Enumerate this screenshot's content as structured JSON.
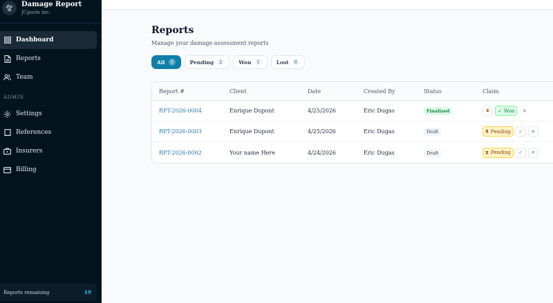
{
  "brand": {
    "title": "Damage Report",
    "subtitle": "JCpools inc."
  },
  "nav": {
    "dashboard": "Dashboard",
    "reports": "Reports",
    "team": "Team",
    "admin_label": "ADMIN",
    "settings": "Settings",
    "references": "References",
    "insurers": "Insurers",
    "billing": "Billing"
  },
  "remaining": {
    "label": "Reports remaining",
    "count": "19"
  },
  "page": {
    "title": "Reports",
    "subtitle": "Manage your damage assessment reports"
  },
  "filters": [
    {
      "label": "All",
      "count": "3",
      "active": true
    },
    {
      "label": "Pending",
      "count": "2"
    },
    {
      "label": "Won",
      "count": "1"
    },
    {
      "label": "Lost",
      "count": "0"
    }
  ],
  "table": {
    "headers": [
      "Report #",
      "Client",
      "Date",
      "Created By",
      "Status",
      "Claim"
    ],
    "rows": [
      {
        "report": "RPT-2026-0004",
        "client": "Enrique Dupont",
        "date": "4/25/2026",
        "created_by": "Eric Dugas",
        "status": "Finalized",
        "claim": "Won"
      },
      {
        "report": "RPT-2026-0003",
        "client": "Enrique Dupont",
        "date": "4/25/2026",
        "created_by": "Eric Dugas",
        "status": "Draft",
        "claim": "Pending"
      },
      {
        "report": "RPT-2026-0002",
        "client": "Your name Here",
        "date": "4/24/2026",
        "created_by": "Eric Dugas",
        "status": "Draft",
        "claim": "Pending"
      }
    ]
  },
  "colors": {
    "sidebar_bg": "#03141f",
    "accent": "#0e7fa6",
    "link": "#2b78a8",
    "won": "#15803d",
    "pending": "#92400e"
  }
}
